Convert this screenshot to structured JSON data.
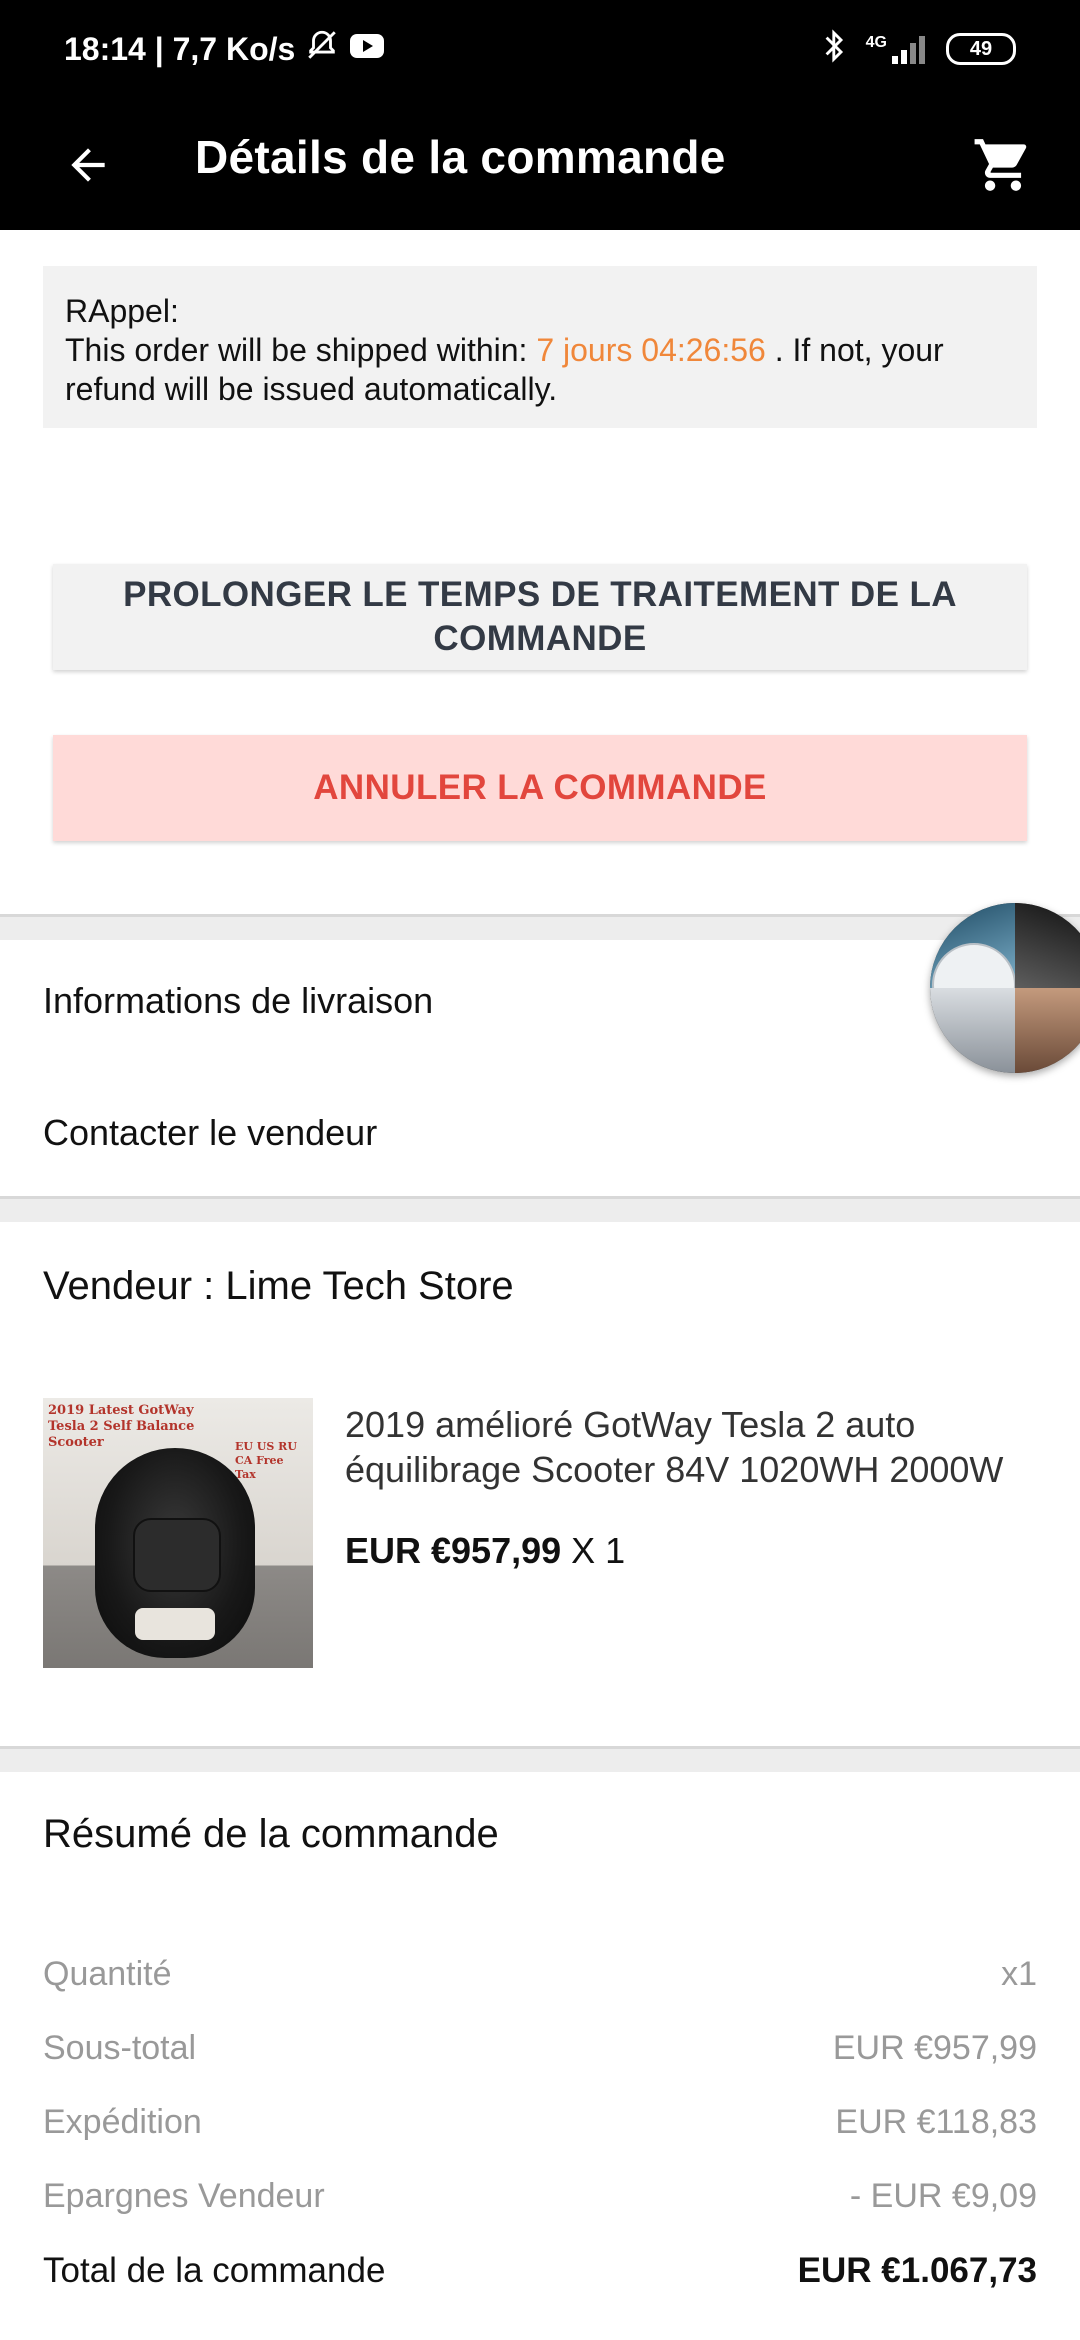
{
  "status_bar": {
    "time_speed": "18:14 | 7,7 Ko/s",
    "network": "4G",
    "battery": "49"
  },
  "app_bar": {
    "title": "Détails de la commande",
    "back_icon": "arrow-left-icon",
    "cart_icon": "cart-icon"
  },
  "reminder": {
    "label": "RAppel:",
    "text_before": "This order will be shipped within: ",
    "countdown": "7 jours 04:26:56",
    "text_after": " . If not, your refund will be issued automatically."
  },
  "actions": {
    "extend_label": "PROLONGER LE TEMPS DE TRAITEMENT DE LA COMMANDE",
    "cancel_label": "ANNULER LA COMMANDE"
  },
  "links": {
    "shipping_info": "Informations de livraison",
    "contact_seller": "Contacter le vendeur"
  },
  "seller": {
    "label": "Vendeur : Lime Tech Store"
  },
  "product": {
    "title_line1": "2019 amélioré GotWay Tesla 2 auto",
    "title_line2": "équilibrage Scooter 84V 1020WH 2000W",
    "price": "EUR €957,99",
    "quantity": "X 1",
    "image_text1": "2019 Latest GotWay Tesla 2 Self Balance Scooter",
    "image_text2": "EU US RU CA Free Tax"
  },
  "summary": {
    "title": "Résumé de la commande",
    "rows": [
      {
        "label": "Quantité",
        "value": "x1"
      },
      {
        "label": "Sous-total",
        "value": "EUR €957,99"
      },
      {
        "label": "Expédition",
        "value": "EUR €118,83"
      },
      {
        "label": "Epargnes Vendeur",
        "value": "- EUR €9,09"
      }
    ],
    "total_label": "Total de la commande",
    "total_value": "EUR €1.067,73"
  },
  "colors": {
    "countdown": "#f0873a",
    "cancel_text": "#e2463d",
    "cancel_bg": "#ffdad8"
  }
}
